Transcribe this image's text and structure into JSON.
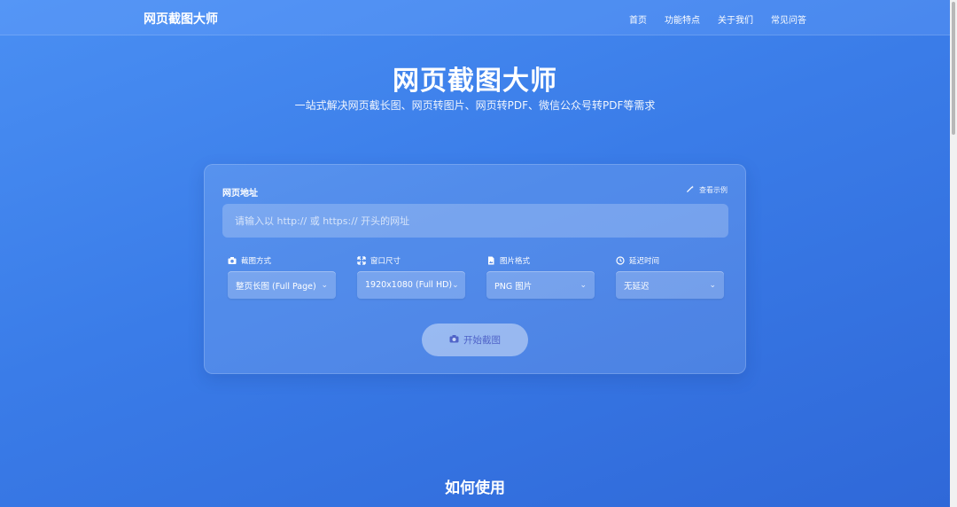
{
  "navbar": {
    "brand": "网页截图大师",
    "links": [
      "首页",
      "功能特点",
      "关于我们",
      "常见问答"
    ]
  },
  "hero": {
    "title": "网页截图大师",
    "subtitle": "一站式解决网页截长图、网页转图片、网页转PDF、微信公众号转PDF等需求"
  },
  "form": {
    "url_label": "网页地址",
    "example_link": "查看示例",
    "url_placeholder": "请输入以 http:// 或 https:// 开头的网址",
    "url_value": "",
    "options": [
      {
        "label": "截图方式",
        "icon": "camera-icon",
        "value": "整页长图 (Full Page)"
      },
      {
        "label": "窗口尺寸",
        "icon": "expand-icon",
        "value": "1920x1080 (Full HD)"
      },
      {
        "label": "图片格式",
        "icon": "image-file-icon",
        "value": "PNG 图片"
      },
      {
        "label": "延迟时间",
        "icon": "clock-icon",
        "value": "无延迟"
      }
    ],
    "start_button": "开始截图"
  },
  "section": {
    "how_title": "如何使用"
  },
  "colors": {
    "background": "#3a7ce8",
    "button_text": "#4f63c8"
  }
}
